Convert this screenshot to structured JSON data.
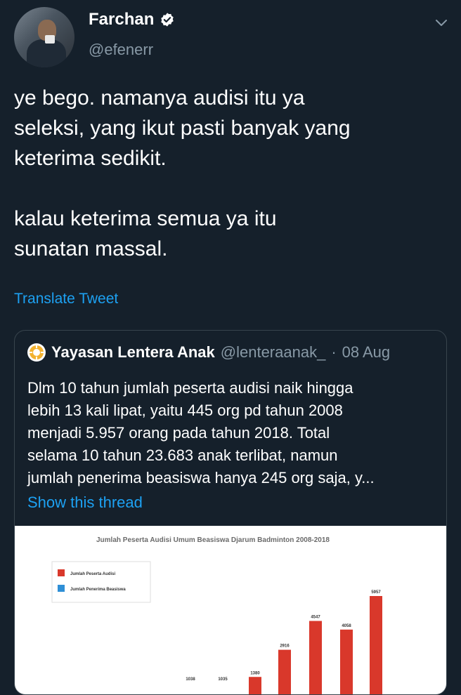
{
  "tweet": {
    "author_name": "Farchan",
    "author_handle": "@efenerr",
    "verified": true,
    "text_lines": [
      "ye bego. namanya audisi itu ya",
      "seleksi, yang ikut pasti banyak yang",
      "keterima sedikit.",
      "",
      "kalau keterima semua ya itu",
      "sunatan massal."
    ],
    "translate_label": "Translate Tweet",
    "icons": {
      "verified": "verified-badge-icon",
      "menu": "chevron-down-icon"
    },
    "colors": {
      "background": "#15202b",
      "link": "#1da1f2",
      "muted": "#8899a6"
    }
  },
  "quoted": {
    "author_name": "Yayasan Lentera Anak",
    "author_handle": "@lenteraanak_",
    "separator": "·",
    "date": "08 Aug",
    "text_lines": [
      "Dlm 10 tahun jumlah peserta audisi naik hingga",
      "lebih 13 kali lipat, yaitu 445 org pd tahun 2008",
      "menjadi 5.957 orang pada tahun 2018. Total",
      "selama 10 tahun 23.683 anak terlibat, namun",
      "jumlah penerima beasiswa hanya 245 org saja, y..."
    ],
    "show_thread_label": "Show this thread"
  },
  "chart_data": {
    "type": "bar",
    "title": "Jumlah Peserta Audisi Umum Beasiswa Djarum Badminton 2008-2018",
    "legend": [
      "Jumlah Peserta Audisi",
      "Jumlah Penerima Beasiswa"
    ],
    "legend_placement": "top-left",
    "series_colors": [
      "#d9382b",
      "#2f8fd6"
    ],
    "visible_value_labels": [
      "1038",
      "1035",
      "1380",
      "2916",
      "4547",
      "4058",
      "5957"
    ],
    "visible_values": [
      1038,
      1035,
      1380,
      2916,
      4547,
      4058,
      5957
    ]
  }
}
